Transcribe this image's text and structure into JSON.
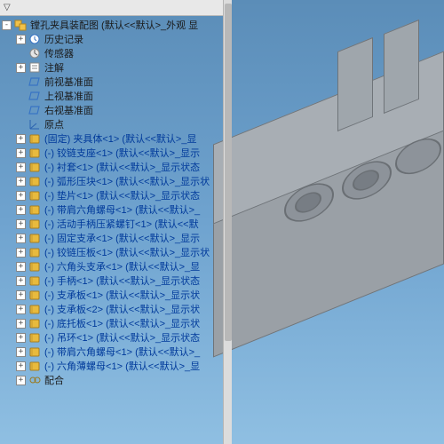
{
  "filter": {
    "label": "▽"
  },
  "root": {
    "label": "镗孔夹具装配图 (默认<<默认>_外观 显",
    "expander": "-"
  },
  "sys": [
    {
      "icon": "hist",
      "label": "历史记录",
      "exp": "+"
    },
    {
      "icon": "sensor",
      "label": "传感器",
      "exp": ""
    },
    {
      "icon": "note",
      "label": "注解",
      "exp": "+"
    },
    {
      "icon": "plane",
      "label": "前视基准面",
      "exp": ""
    },
    {
      "icon": "plane",
      "label": "上视基准面",
      "exp": ""
    },
    {
      "icon": "plane",
      "label": "右视基准面",
      "exp": ""
    },
    {
      "icon": "origin",
      "label": "原点",
      "exp": ""
    }
  ],
  "parts": [
    "(固定) 夹具体<1> (默认<<默认>_显",
    "(-) 铰链支座<1> (默认<<默认>_显示",
    "(-) 衬套<1> (默认<<默认>_显示状态",
    "(-) 弧形压块<1> (默认<<默认>_显示状",
    "(-) 垫片<1> (默认<<默认>_显示状态",
    "(-) 带肩六角螺母<1> (默认<<默认>_",
    "(-) 活动手柄压紧螺钉<1> (默认<<默",
    "(-) 固定支承<1> (默认<<默认>_显示",
    "(-) 铰链压板<1> (默认<<默认>_显示状",
    "(-) 六角头支承<1> (默认<<默认>_显",
    "(-) 手柄<1> (默认<<默认>_显示状态",
    "(-) 支承板<1> (默认<<默认>_显示状",
    "(-) 支承板<2> (默认<<默认>_显示状",
    "(-) 底托板<1> (默认<<默认>_显示状",
    "(-) 吊环<1> (默认<<默认>_显示状态",
    "(-) 带肩六角螺母<1> (默认<<默认>_",
    "(-) 六角薄螺母<1> (默认<<默认>_显"
  ],
  "tail": {
    "label": "配合",
    "exp": "+"
  },
  "colors": {
    "part": "#d9a72f",
    "folder": "#c5a75b"
  }
}
